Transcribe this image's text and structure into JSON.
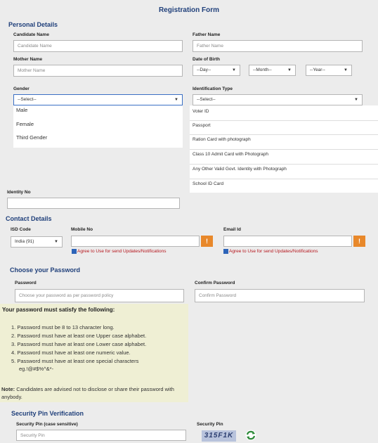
{
  "form_title": "Registration Form",
  "personal": {
    "heading": "Personal Details",
    "candidate_name": {
      "label": "Candidate Name",
      "placeholder": "Candidate Name"
    },
    "father_name": {
      "label": "Father Name",
      "placeholder": "Father Name"
    },
    "mother_name": {
      "label": "Mother Name",
      "placeholder": "Mother Name"
    },
    "dob": {
      "label": "Date of Birth",
      "day": "--Day--",
      "month": "--Month--",
      "year": "--Year--"
    },
    "gender": {
      "label": "Gender",
      "value": "--Select--",
      "options": [
        "Male",
        "Female",
        "Third Gender"
      ]
    },
    "id_type": {
      "label": "Identification Type",
      "value": "--Select--",
      "options": [
        "Voter ID",
        "Passport",
        "Ration Card with photograph",
        "Class 10 Admit Card with Photograph",
        "Any Other Valid Govt. Identity with Photograph",
        "School ID Card"
      ]
    },
    "identity_no": {
      "label": "Identity No"
    }
  },
  "contact": {
    "heading": "Contact Details",
    "isd_label": "ISD Code",
    "isd_value": "India (91)",
    "mobile_label": "Mobile No",
    "email_label": "Email Id",
    "warn_glyph": "!",
    "mobile_consent": "Agree to Use for send Updates/Notifications",
    "email_consent": "Agree to Use for send Updates/Notifications"
  },
  "password": {
    "heading": "Choose your Password",
    "password_label": "Password",
    "password_placeholder": "Choose your password as per password policy",
    "confirm_label": "Confirm Password",
    "confirm_placeholder": "Confirm Password",
    "rules_heading": "Your password must satisfy the following:",
    "rules": [
      "1. Password must be 8 to 13 character long.",
      "2. Password must have at least one Upper case alphabet.",
      "3. Password must have at least one Lower case alphabet.",
      "4. Password must have at least one numeric value.",
      "5. Password must have at least one special characters"
    ],
    "rules_example": "eg.!@#$%^&*-",
    "note_label": "Note:",
    "note_text": " Candidates are advised not to disclose or share their password with anybody."
  },
  "security": {
    "heading": "Security Pin Verification",
    "pin_input_label": "Security Pin (case sensitive)",
    "pin_placeholder": "Security Pin",
    "pin_label": "Security Pin",
    "captcha": "315F1K"
  },
  "colors": {
    "heading": "#1f3f7a",
    "warn": "#e8882a",
    "consent": "#b5151c",
    "rules_bg": "#efefd4"
  }
}
